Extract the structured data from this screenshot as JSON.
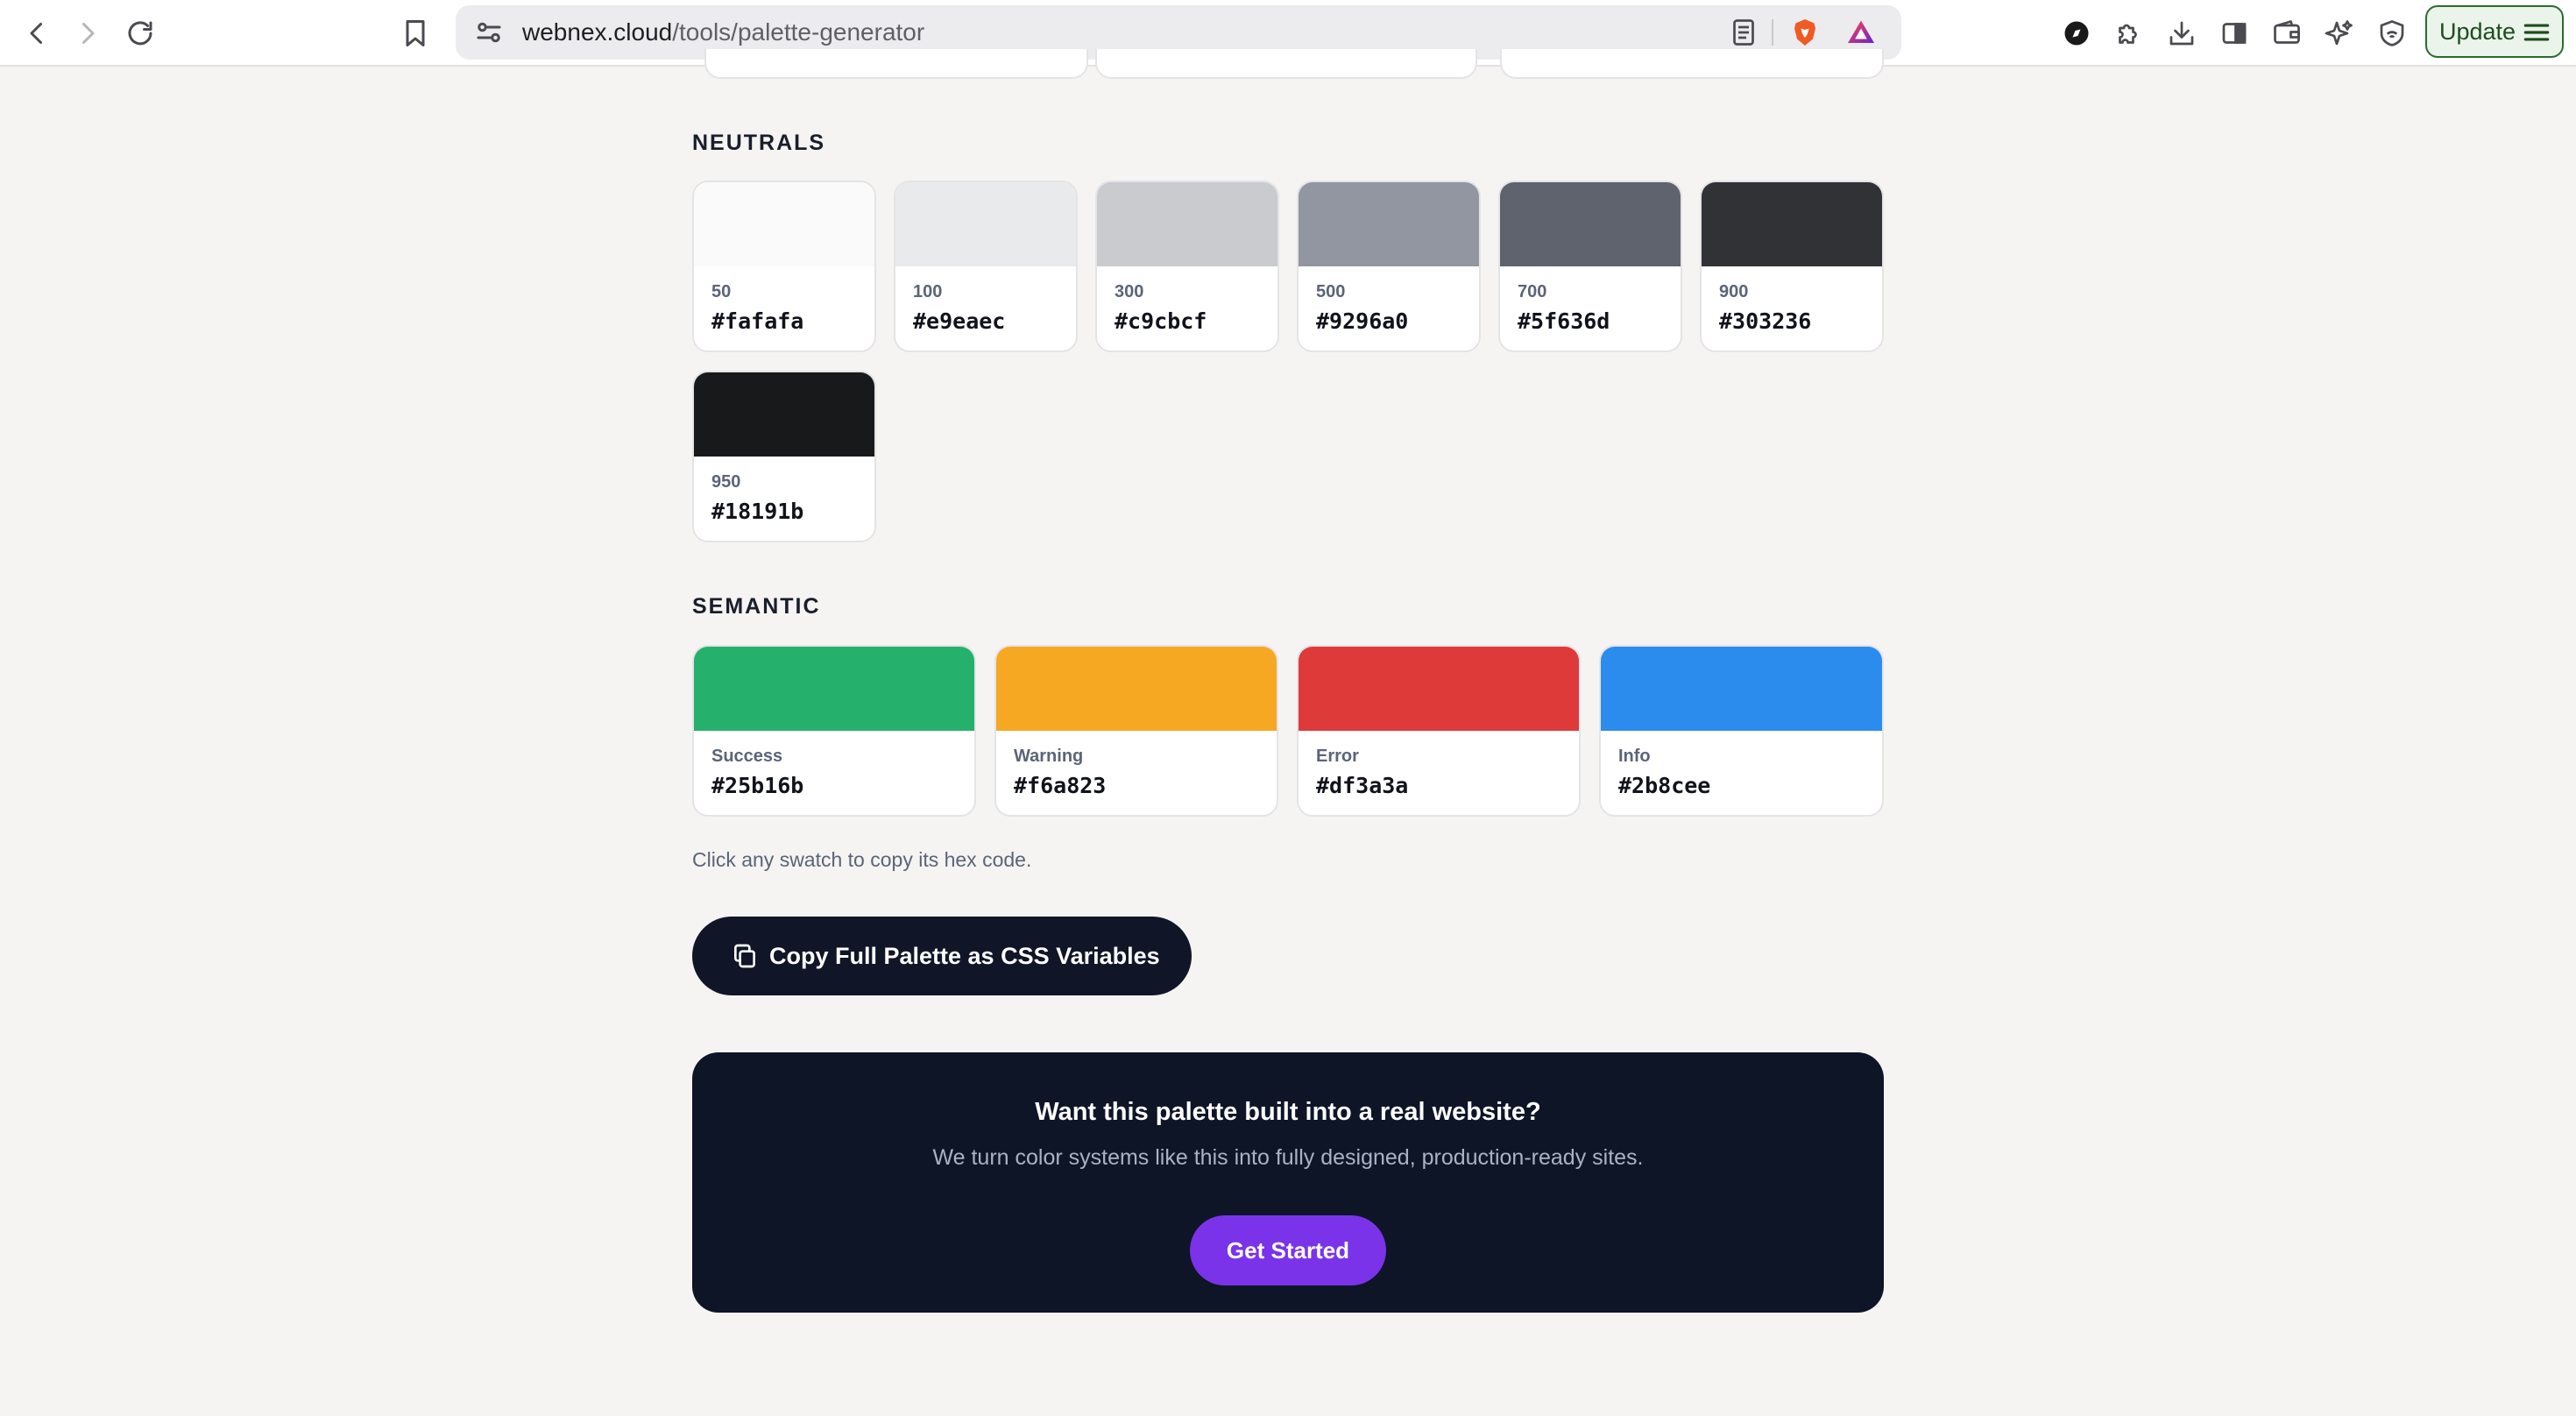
{
  "browser": {
    "url_host": "webnex.cloud",
    "url_path": "/tools/palette-generator",
    "update_label": "Update"
  },
  "neutrals": {
    "title": "NEUTRALS",
    "swatches": [
      {
        "label": "50",
        "hex": "#fafafa",
        "color": "#fafafa"
      },
      {
        "label": "100",
        "hex": "#e9eaec",
        "color": "#e9eaec"
      },
      {
        "label": "300",
        "hex": "#c9cbcf",
        "color": "#c9cbcf"
      },
      {
        "label": "500",
        "hex": "#9296a0",
        "color": "#9296a0"
      },
      {
        "label": "700",
        "hex": "#5f636d",
        "color": "#5f636d"
      },
      {
        "label": "900",
        "hex": "#303236",
        "color": "#303236"
      },
      {
        "label": "950",
        "hex": "#18191b",
        "color": "#18191b"
      }
    ]
  },
  "semantic": {
    "title": "SEMANTIC",
    "swatches": [
      {
        "label": "Success",
        "hex": "#25b16b",
        "color": "#25b16b"
      },
      {
        "label": "Warning",
        "hex": "#f6a823",
        "color": "#f6a823"
      },
      {
        "label": "Error",
        "hex": "#df3a3a",
        "color": "#df3a3a"
      },
      {
        "label": "Info",
        "hex": "#2b8cee",
        "color": "#2b8cee"
      }
    ]
  },
  "hint": "Click any swatch to copy its hex code.",
  "copy_button_label": "Copy Full Palette as CSS Variables",
  "cta": {
    "title": "Want this palette built into a real website?",
    "subtitle": "We turn color systems like this into fully designed, production-ready sites.",
    "button_label": "Get Started"
  },
  "colors": {
    "page_bg": "#f5f4f2",
    "dark": "#0e1527",
    "accent": "#7a33e8"
  }
}
